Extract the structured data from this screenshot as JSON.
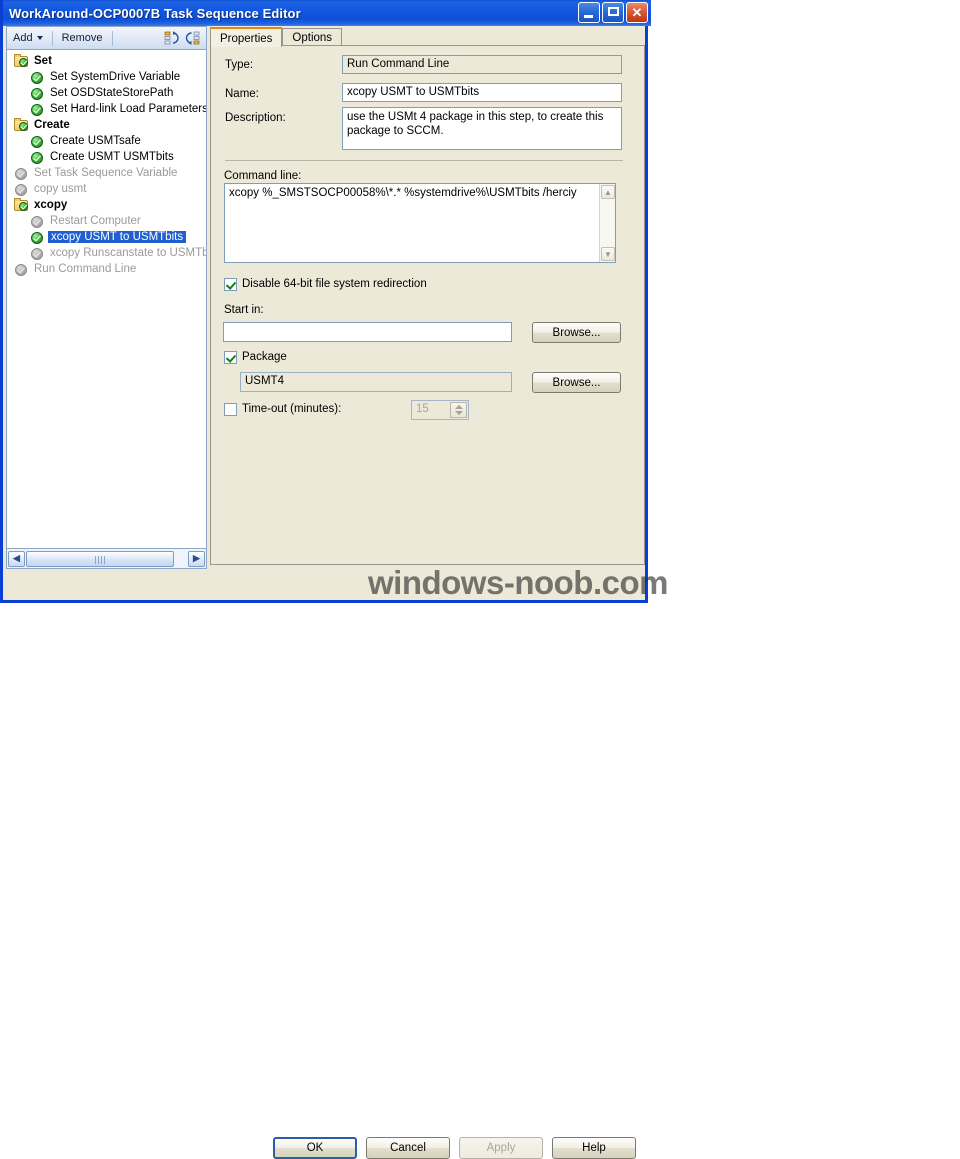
{
  "window": {
    "title": "WorkAround-OCP0007B Task Sequence Editor",
    "minimize_label": "",
    "maximize_label": "",
    "close_label": "✕"
  },
  "toolbar": {
    "add_label": "Add",
    "remove_label": "Remove",
    "move_up_icon": "move-up-icon",
    "move_down_icon": "move-down-icon"
  },
  "tree": {
    "items": [
      {
        "label": "Set",
        "type": "folder",
        "depth": 0,
        "state": "enabled",
        "selected": false
      },
      {
        "label": "Set SystemDrive Variable",
        "type": "step",
        "depth": 1,
        "state": "enabled",
        "selected": false
      },
      {
        "label": "Set OSDStateStorePath",
        "type": "step",
        "depth": 1,
        "state": "enabled",
        "selected": false
      },
      {
        "label": "Set Hard-link Load Parameters",
        "type": "step",
        "depth": 1,
        "state": "enabled",
        "selected": false
      },
      {
        "label": "Create",
        "type": "folder",
        "depth": 0,
        "state": "enabled",
        "selected": false
      },
      {
        "label": "Create USMTsafe",
        "type": "step",
        "depth": 1,
        "state": "enabled",
        "selected": false
      },
      {
        "label": "Create USMT USMTbits",
        "type": "step",
        "depth": 1,
        "state": "enabled",
        "selected": false
      },
      {
        "label": "Set Task Sequence Variable",
        "type": "step",
        "depth": 0,
        "state": "disabled",
        "selected": false
      },
      {
        "label": "copy usmt",
        "type": "step",
        "depth": 0,
        "state": "disabled",
        "selected": false
      },
      {
        "label": "xcopy",
        "type": "folder",
        "depth": 0,
        "state": "enabled",
        "selected": false
      },
      {
        "label": "Restart Computer",
        "type": "step",
        "depth": 1,
        "state": "disabled",
        "selected": false
      },
      {
        "label": "xcopy USMT to USMTbits",
        "type": "step",
        "depth": 1,
        "state": "enabled",
        "selected": true
      },
      {
        "label": "xcopy Runscanstate to USMTbi",
        "type": "step",
        "depth": 1,
        "state": "disabled",
        "selected": false
      },
      {
        "label": "Run Command Line",
        "type": "step",
        "depth": 0,
        "state": "disabled",
        "selected": false
      }
    ],
    "scroll_left_icon": "◀",
    "scroll_right_icon": "▶"
  },
  "tabs": [
    {
      "label": "Properties",
      "active": true
    },
    {
      "label": "Options",
      "active": false
    }
  ],
  "properties": {
    "type_label": "Type:",
    "type_value": "Run Command Line",
    "name_label": "Name:",
    "name_value": "xcopy USMT to USMTbits",
    "description_label": "Description:",
    "description_value": "use the USMt 4 package in this step, to create this package to SCCM.",
    "command_line_label": "Command line:",
    "command_line_value": "xcopy %_SMSTSOCP00058%\\*.* %systemdrive%\\USMTbits /herciy",
    "disable_redirection_label": "Disable 64-bit file system redirection",
    "disable_redirection_checked": true,
    "start_in_label": "Start in:",
    "start_in_value": "",
    "start_in_browse_label": "Browse...",
    "package_label": "Package",
    "package_checked": true,
    "package_value": "USMT4",
    "package_browse_label": "Browse...",
    "timeout_label": "Time-out (minutes):",
    "timeout_checked": false,
    "timeout_value": "15",
    "scroll_up_icon": "▲",
    "scroll_down_icon": "▼"
  },
  "footer": {
    "ok_label": "OK",
    "cancel_label": "Cancel",
    "apply_label": "Apply",
    "apply_disabled": true,
    "help_label": "Help"
  },
  "watermark": {
    "text": "windows-noob.com"
  },
  "colors": {
    "titlebar_blue": "#0b52d4",
    "window_border": "#0a3fd6",
    "dialog_bg": "#ece9d8",
    "selection_blue": "#1f5fd0",
    "active_tab_accent": "#e08a16",
    "check_green": "#34a534"
  }
}
